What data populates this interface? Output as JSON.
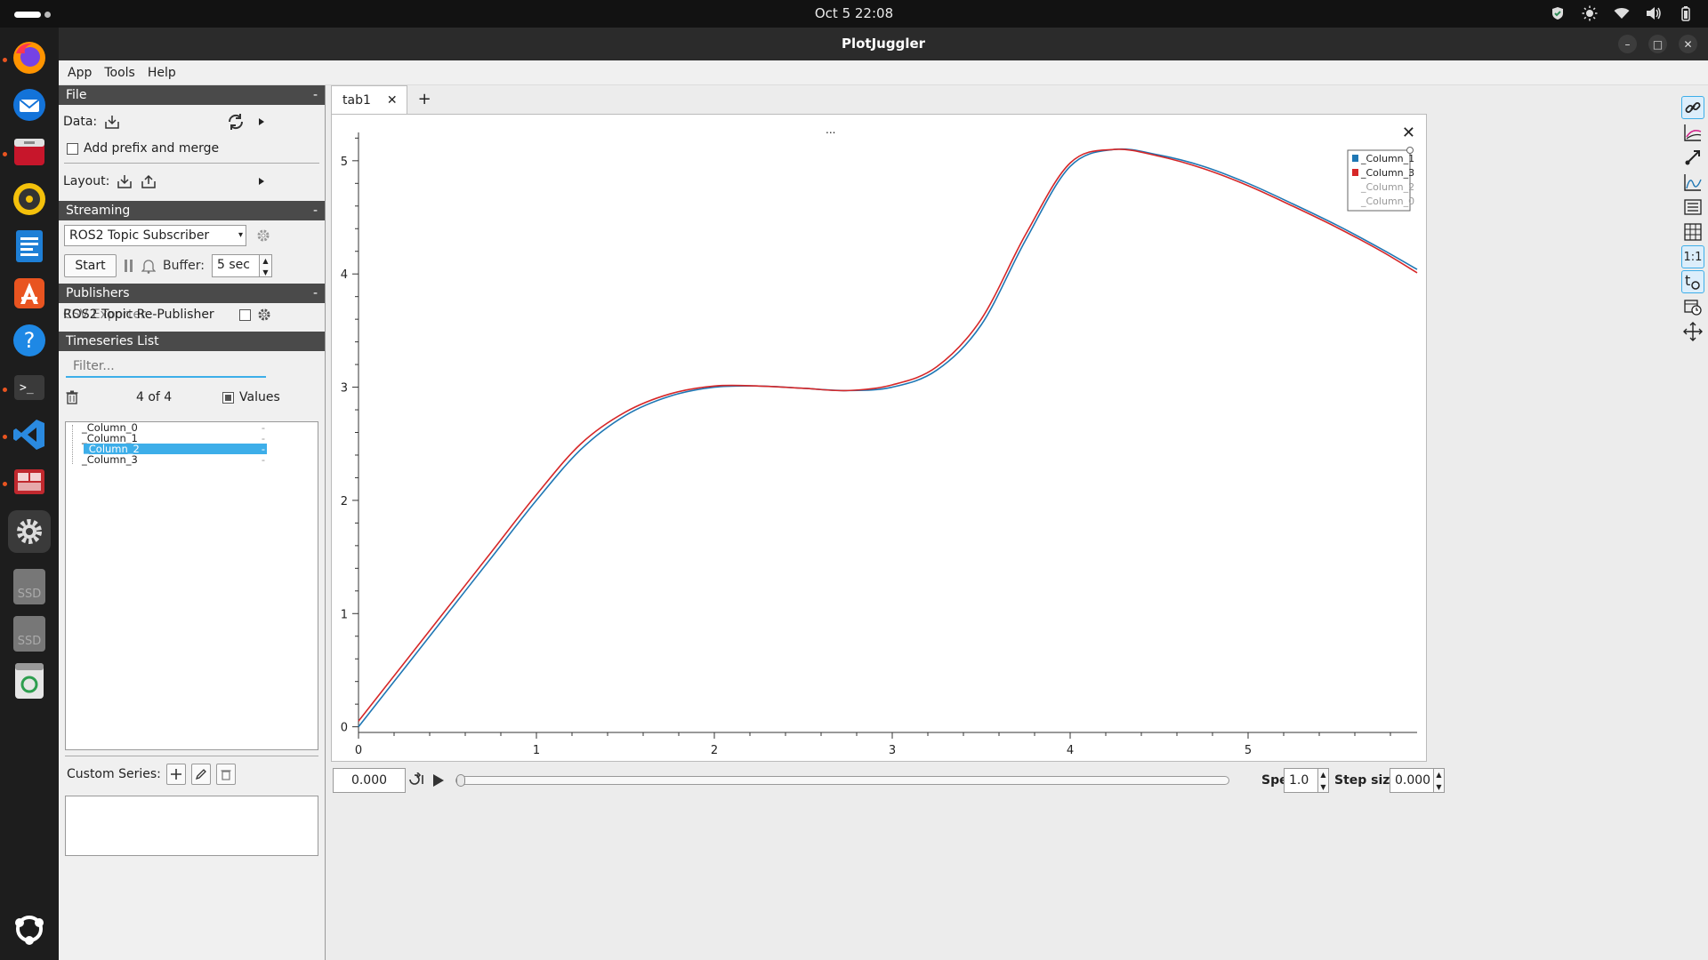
{
  "topbar": {
    "clock": "Oct 5  22:08"
  },
  "window": {
    "title": "PlotJuggler"
  },
  "menu": [
    "App",
    "Tools",
    "Help"
  ],
  "file_section": {
    "title": "File",
    "data_label": "Data:",
    "prefix_merge_label": "Add prefix and merge",
    "layout_label": "Layout:"
  },
  "streaming": {
    "title": "Streaming",
    "plugin": "ROS2 Topic Subscriber",
    "start_label": "Start",
    "buffer_label": "Buffer:",
    "buffer_value": "5 sec"
  },
  "publishers": {
    "title": "Publishers",
    "item_label": "ROS2 Topic Re-Publisher",
    "overlap_label": "CSV Exporter"
  },
  "timeseries": {
    "title": "Timeseries List",
    "filter_placeholder": "Filter...",
    "count": "4 of 4",
    "values_label": "Values",
    "items": [
      "_Column_0",
      "_Column_1",
      "_Column_2",
      "_Column_3"
    ],
    "selected_index": 2
  },
  "custom_series": {
    "label": "Custom Series:"
  },
  "tabs": {
    "active": "tab1",
    "add": "+"
  },
  "plot_header": "...",
  "chart_data": {
    "type": "line",
    "xlim": [
      0,
      5.95
    ],
    "ylim": [
      -0.05,
      5.25
    ],
    "xticks": [
      "0",
      "1",
      "2",
      "3",
      "4",
      "5"
    ],
    "yticks": [
      "0",
      "1",
      "2",
      "3",
      "4",
      "5"
    ],
    "grid": false,
    "legend_position": "top-right",
    "legend": [
      {
        "name": "_Column_1",
        "color": "#1f77b4",
        "active": true
      },
      {
        "name": "_Column_3",
        "color": "#d62728",
        "active": true
      },
      {
        "name": "_Column_2",
        "color": "#999999",
        "active": false
      },
      {
        "name": "_Column_0",
        "color": "#999999",
        "active": false
      }
    ],
    "series": [
      {
        "name": "_Column_1",
        "color": "#1f77b4",
        "x": [
          0,
          0.25,
          0.5,
          0.75,
          1.0,
          1.25,
          1.5,
          1.75,
          2.0,
          2.25,
          2.5,
          2.75,
          3.0,
          3.25,
          3.5,
          3.75,
          4.0,
          4.25,
          4.5,
          4.75,
          5.0,
          5.25,
          5.5,
          5.75,
          5.95
        ],
        "values": [
          0.0,
          0.5,
          1.0,
          1.5,
          2.0,
          2.45,
          2.75,
          2.92,
          3.0,
          3.01,
          2.99,
          2.97,
          3.0,
          3.15,
          3.55,
          4.3,
          4.95,
          5.1,
          5.05,
          4.95,
          4.8,
          4.62,
          4.43,
          4.22,
          4.04
        ]
      },
      {
        "name": "_Column_3",
        "color": "#d62728",
        "x": [
          0,
          0.25,
          0.5,
          0.75,
          1.0,
          1.25,
          1.5,
          1.75,
          2.0,
          2.25,
          2.5,
          2.75,
          3.0,
          3.25,
          3.5,
          3.75,
          4.0,
          4.25,
          4.5,
          4.75,
          5.0,
          5.25,
          5.5,
          5.75,
          5.95
        ],
        "values": [
          0.05,
          0.55,
          1.05,
          1.55,
          2.05,
          2.5,
          2.78,
          2.94,
          3.01,
          3.01,
          2.99,
          2.97,
          3.02,
          3.18,
          3.6,
          4.35,
          4.98,
          5.1,
          5.04,
          4.93,
          4.78,
          4.6,
          4.41,
          4.2,
          4.01
        ]
      }
    ]
  },
  "playback": {
    "time_value": "0.000",
    "speed_label": "Speed:",
    "speed_value": "1.0",
    "step_label": "Step size:",
    "step_value": "0.000"
  }
}
